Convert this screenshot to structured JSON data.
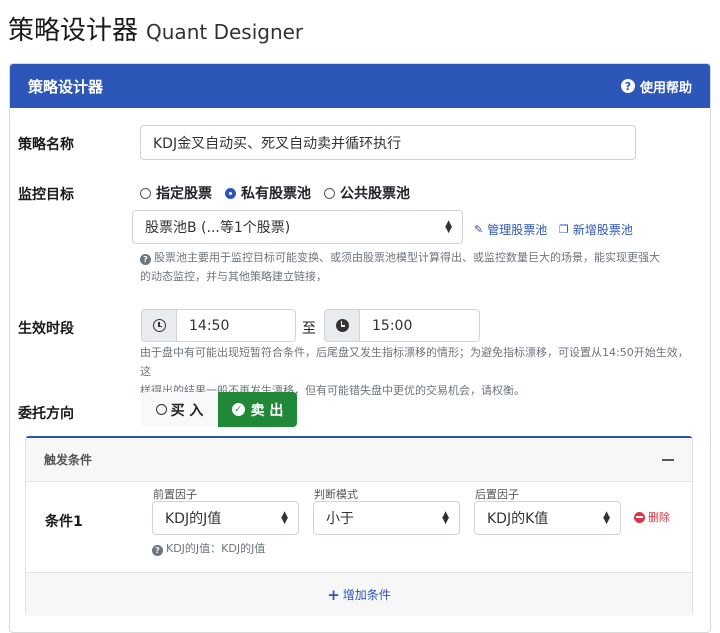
{
  "app": {
    "title_cn": "策略设计器",
    "title_en": "Quant Designer"
  },
  "card": {
    "title": "策略设计器",
    "help_label": "使用帮助"
  },
  "strategy_name": {
    "label": "策略名称",
    "value": "KDJ金叉自动买、死叉自动卖并循环执行"
  },
  "monitor": {
    "label": "监控目标",
    "options": [
      {
        "label": "指定股票",
        "selected": false
      },
      {
        "label": "私有股票池",
        "selected": true
      },
      {
        "label": "公共股票池",
        "selected": false
      }
    ],
    "pool_select": "股票池B (...等1个股票)",
    "manage_link": "管理股票池",
    "new_link": "新增股票池",
    "hint_line1": "股票池主要用于监控目标可能变换、或须由股票池模型计算得出、或监控数量巨大的场景，能实现更强大",
    "hint_line2": "的动态监控，并与其他策略建立链接，"
  },
  "effective_time": {
    "label": "生效时段",
    "start": "14:50",
    "separator": "至",
    "end": "15:00",
    "hint_line1": "由于盘中有可能出现短暂符合条件，后尾盘又发生指标漂移的情形；为避免指标漂移，可设置从14:50开始生效，这",
    "hint_line2": "样得出的结果一般不再发生漂移，但有可能错失盘中更优的交易机会，请权衡。"
  },
  "direction": {
    "label": "委托方向",
    "buy": "买 入",
    "sell": "卖 出",
    "selected": "sell"
  },
  "trigger": {
    "title": "触发条件",
    "col_front": "前置因子",
    "col_mode": "判断模式",
    "col_back": "后置因子",
    "conditions": [
      {
        "name": "条件1",
        "front": "KDJ的J值",
        "mode": "小于",
        "back": "KDJ的K值",
        "delete_label": "删除",
        "hint": "KDJ的J值：KDJ的J值"
      }
    ],
    "add_label": "增加条件"
  },
  "colors": {
    "primary": "#2c57b9",
    "success": "#218838",
    "danger": "#dc3545"
  }
}
